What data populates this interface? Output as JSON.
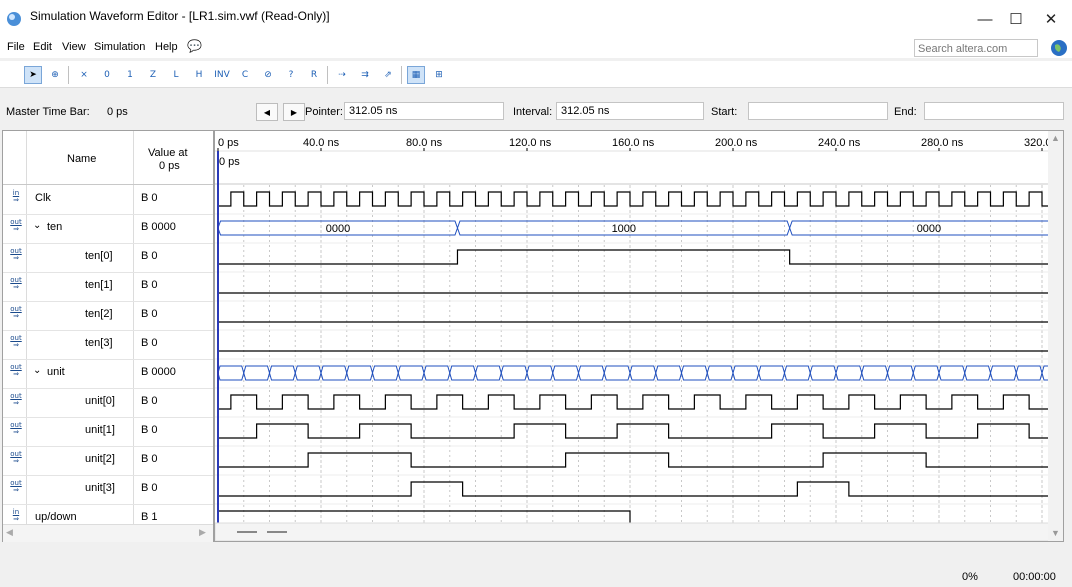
{
  "window": {
    "title": "Simulation Waveform Editor - [LR1.sim.vwf (Read-Only)]",
    "minimize": "—",
    "maximize": "☐",
    "close": "✕"
  },
  "menu": [
    "File",
    "Edit",
    "View",
    "Simulation",
    "Help"
  ],
  "search": {
    "placeholder": "Search altera.com"
  },
  "timebar": {
    "master_label": "Master Time Bar:",
    "master_value": "0 ps",
    "pointer_label": "Pointer:",
    "pointer_value": "312.05 ns",
    "interval_label": "Interval:",
    "interval_value": "312.05 ns",
    "start_label": "Start:",
    "start_value": "",
    "end_label": "End:",
    "end_value": ""
  },
  "table": {
    "name_header": "Name",
    "value_header_1": "Value at",
    "value_header_2": "0 ps"
  },
  "signals": [
    {
      "dir": "in",
      "name": "Clk",
      "value": "B 0",
      "indent": 0
    },
    {
      "dir": "out",
      "name": "ten",
      "value": "B 0000",
      "indent": 0,
      "group": true
    },
    {
      "dir": "out",
      "name": "ten[0]",
      "value": "B 0",
      "indent": 1
    },
    {
      "dir": "out",
      "name": "ten[1]",
      "value": "B 0",
      "indent": 1
    },
    {
      "dir": "out",
      "name": "ten[2]",
      "value": "B 0",
      "indent": 1
    },
    {
      "dir": "out",
      "name": "ten[3]",
      "value": "B 0",
      "indent": 1
    },
    {
      "dir": "out",
      "name": "unit",
      "value": "B 0000",
      "indent": 0,
      "group": true
    },
    {
      "dir": "out",
      "name": "unit[0]",
      "value": "B 0",
      "indent": 1
    },
    {
      "dir": "out",
      "name": "unit[1]",
      "value": "B 0",
      "indent": 1
    },
    {
      "dir": "out",
      "name": "unit[2]",
      "value": "B 0",
      "indent": 1
    },
    {
      "dir": "out",
      "name": "unit[3]",
      "value": "B 0",
      "indent": 1
    },
    {
      "dir": "in",
      "name": "up/down",
      "value": "B 1",
      "indent": 0
    }
  ],
  "timeline": {
    "ticks": [
      "0 ps",
      "40.0 ns",
      "80.0 ns",
      "120.0 ns",
      "160.0 ns",
      "200.0 ns",
      "240.0 ns",
      "280.0 ns",
      "320.0"
    ],
    "cursor_label": "0 ps"
  },
  "waves": {
    "ten_bus_labels": [
      "0000",
      "1000",
      "0000"
    ],
    "ten_bus_changes_ns": [
      93,
      222
    ]
  },
  "status": {
    "progress": "0%",
    "time": "00:00:00"
  },
  "colors": {
    "wave": "#000000",
    "bus": "#1f4fbf",
    "cursor": "#2a3ab8",
    "grid": "#c8c8c8"
  }
}
